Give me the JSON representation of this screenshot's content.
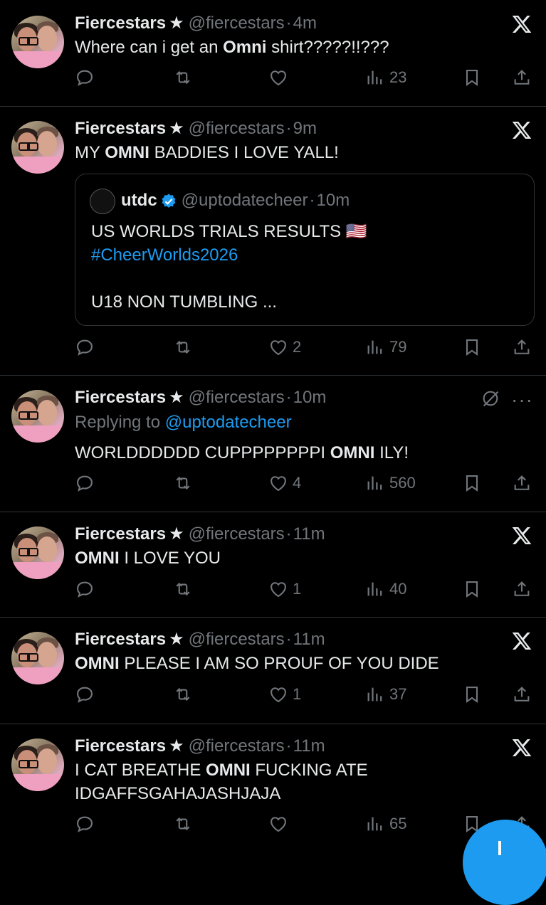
{
  "tweets": [
    {
      "name": "Fiercestars",
      "star": "★",
      "handle": "@fiercestars",
      "sep": "·",
      "time": "4m",
      "text_parts": [
        "Where can i get an ",
        "Omni",
        " shirt?????!!???"
      ],
      "stats": {
        "views": "23"
      }
    },
    {
      "name": "Fiercestars",
      "star": "★",
      "handle": "@fiercestars",
      "sep": "·",
      "time": "9m",
      "text_parts": [
        "MY ",
        "OMNI",
        " BADDIES I LOVE YALL!"
      ],
      "quote": {
        "name": "utdc",
        "handle": "@uptodatecheer",
        "sep": "·",
        "time": "10m",
        "line1": "US WORLDS TRIALS RESULTS 🇺🇸",
        "hashtag": "#CheerWorlds2026",
        "line3": "U18 NON TUMBLING ..."
      },
      "stats": {
        "likes": "2",
        "views": "79"
      }
    },
    {
      "name": "Fiercestars",
      "star": "★",
      "handle": "@fiercestars",
      "sep": "·",
      "time": "10m",
      "reply_prefix": "Replying to ",
      "reply_handle": "@uptodatecheer",
      "text_parts": [
        "WORLDDDDDD CUPPPPPPPPI ",
        "OMNI",
        " ILY!"
      ],
      "more": "···",
      "stats": {
        "likes": "4",
        "views": "560"
      }
    },
    {
      "name": "Fiercestars",
      "star": "★",
      "handle": "@fiercestars",
      "sep": "·",
      "time": "11m",
      "text_parts": [
        "",
        "OMNI",
        " I LOVE YOU"
      ],
      "stats": {
        "likes": "1",
        "views": "40"
      }
    },
    {
      "name": "Fiercestars",
      "star": "★",
      "handle": "@fiercestars",
      "sep": "·",
      "time": "11m",
      "text_parts": [
        "",
        "OMNI",
        " PLEASE I AM SO PROUF OF YOU DIDE"
      ],
      "stats": {
        "likes": "1",
        "views": "37"
      }
    },
    {
      "name": "Fiercestars",
      "star": "★",
      "handle": "@fiercestars",
      "sep": "·",
      "time": "11m",
      "text_parts": [
        "I CAT BREATHE ",
        "OMNI",
        " FUCKING ATE\nIDGAFFSGAHAJASHJAJA"
      ],
      "stats": {
        "views": "65"
      }
    }
  ],
  "colors": {
    "background": "#000000",
    "text": "#e7e9ea",
    "muted": "#71767b",
    "link": "#1d9bf0",
    "divider": "#2f3336"
  },
  "icons": [
    "x-logo-icon",
    "reply-icon",
    "retweet-icon",
    "like-icon",
    "views-icon",
    "bookmark-icon",
    "share-icon",
    "verified-icon",
    "grok-slash-icon",
    "more-icon",
    "compose-icon"
  ]
}
